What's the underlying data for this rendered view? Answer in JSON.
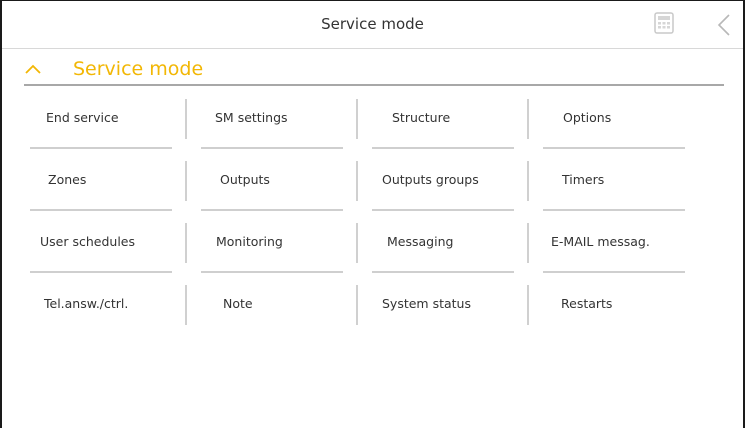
{
  "topbar": {
    "title": "Service mode",
    "calculator_icon": "calculator-icon",
    "back_icon": "chevron-left-icon"
  },
  "section": {
    "title": "Service mode",
    "chevron_icon": "chevron-up-icon",
    "accent_color": "#f2b705"
  },
  "menu": {
    "rows": [
      [
        {
          "label": "End service"
        },
        {
          "label": "SM settings"
        },
        {
          "label": "Structure"
        },
        {
          "label": "Options"
        }
      ],
      [
        {
          "label": "Zones"
        },
        {
          "label": "Outputs"
        },
        {
          "label": "Outputs groups"
        },
        {
          "label": "Timers"
        }
      ],
      [
        {
          "label": "User schedules"
        },
        {
          "label": "Monitoring"
        },
        {
          "label": "Messaging"
        },
        {
          "label": "E-MAIL messag."
        }
      ],
      [
        {
          "label": "Tel.answ./ctrl."
        },
        {
          "label": "Note"
        },
        {
          "label": "System status"
        },
        {
          "label": "Restarts"
        }
      ]
    ]
  }
}
